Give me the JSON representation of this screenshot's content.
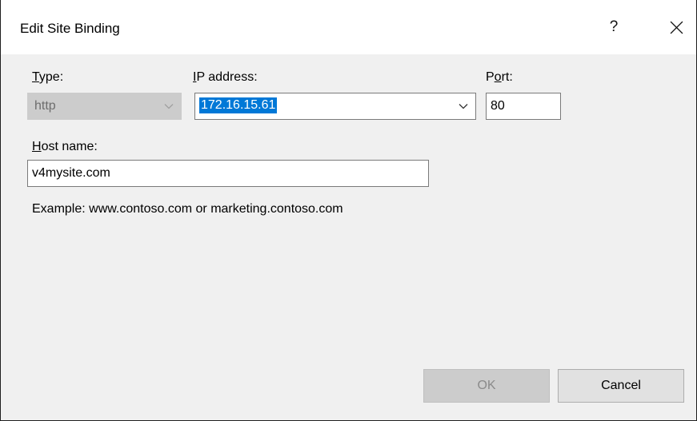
{
  "window": {
    "title": "Edit Site Binding",
    "help_label": "?",
    "close_icon": "close-icon"
  },
  "type": {
    "label_first": "T",
    "label_rest": "ype:",
    "value": "http",
    "enabled": false
  },
  "ip_address": {
    "label_first": "I",
    "label_rest": "P address:",
    "value": "172.16.15.61"
  },
  "port": {
    "label_pre": "P",
    "label_underlined": "o",
    "label_post": "rt:",
    "value": "80"
  },
  "host_name": {
    "label_first": "H",
    "label_rest": "ost name:",
    "value": "v4mysite.com"
  },
  "example_text": "Example: www.contoso.com or marketing.contoso.com",
  "buttons": {
    "ok_label": "OK",
    "ok_enabled": false,
    "cancel_label": "Cancel"
  },
  "colors": {
    "selection": "#0078d7",
    "dialog_background": "#f0f0f0",
    "disabled": "#cccccc"
  }
}
